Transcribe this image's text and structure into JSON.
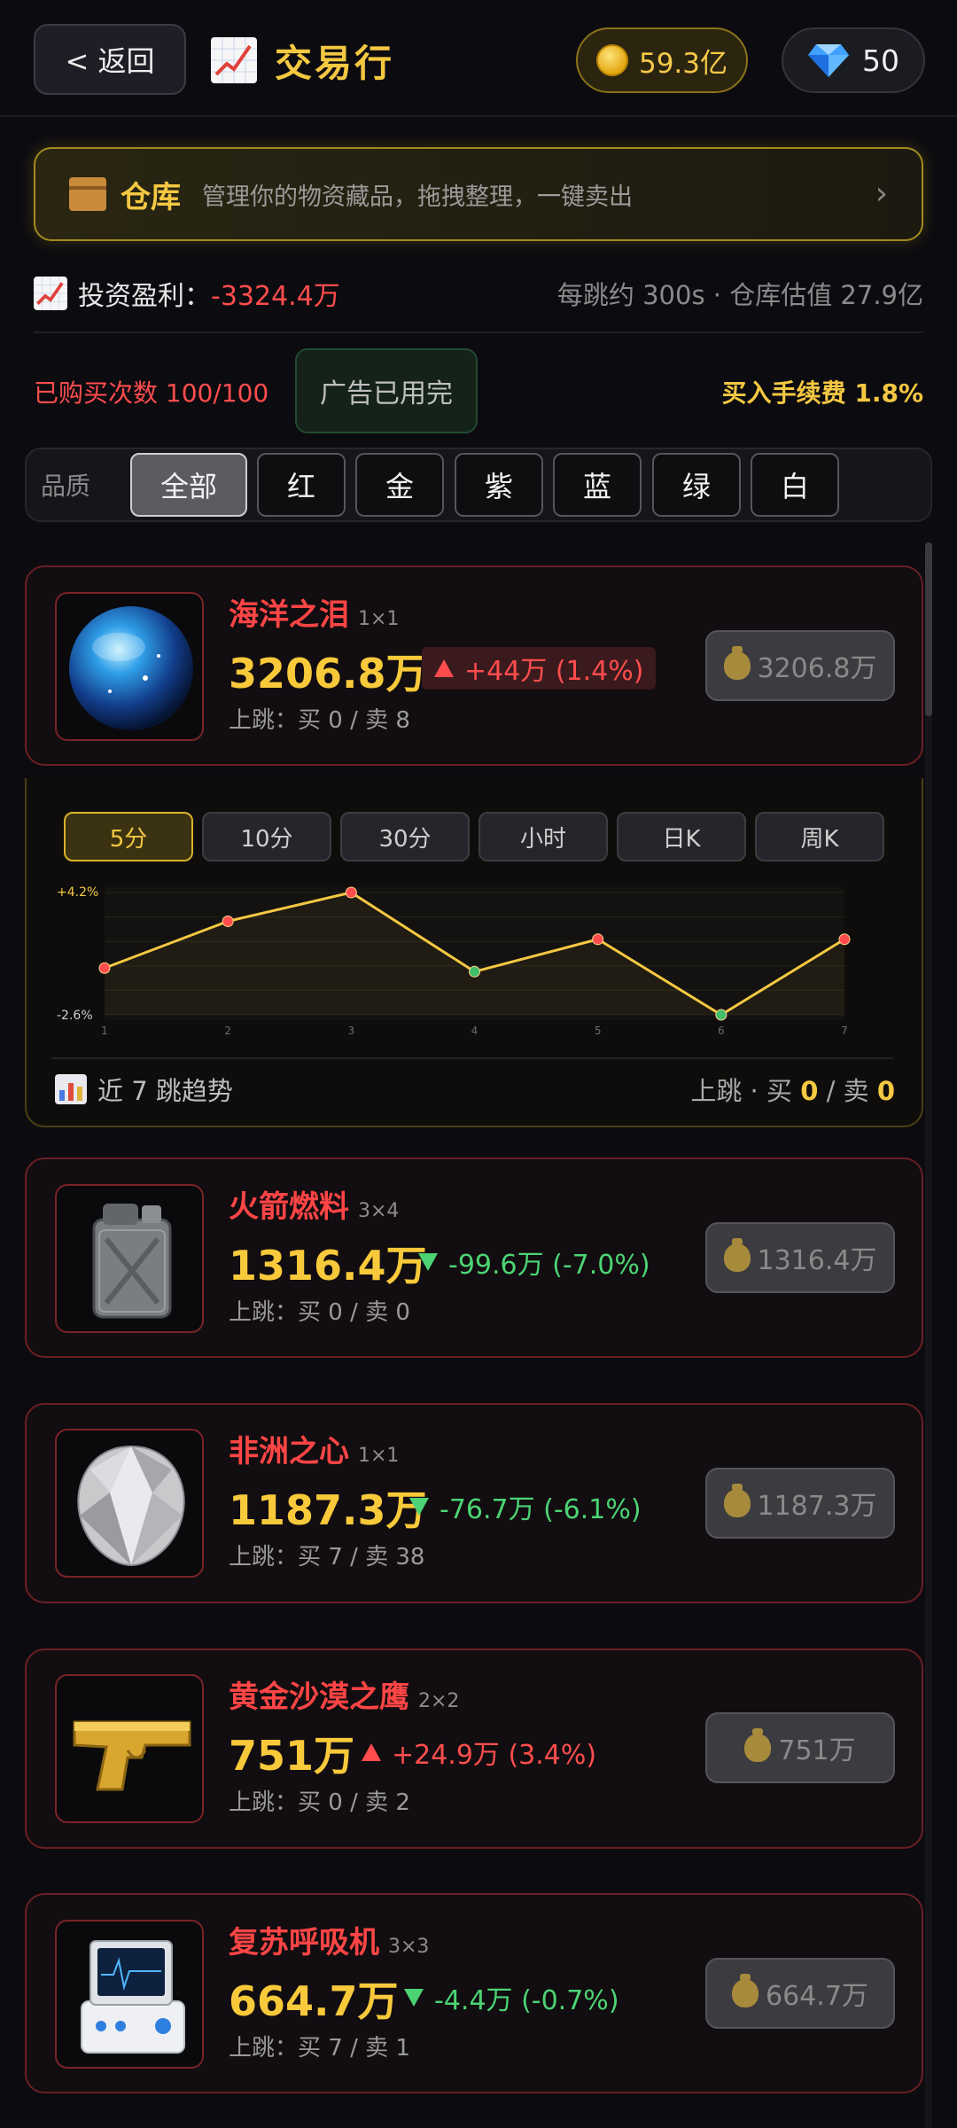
{
  "header": {
    "back_label": "< 返回",
    "title": "交易行",
    "coins": "59.3亿",
    "gems": "50"
  },
  "warehouse": {
    "title": "仓库",
    "desc": "管理你的物资藏品，拖拽整理，一键卖出",
    "arrow": "›"
  },
  "stats": {
    "profit_label": "投资盈利：",
    "profit_value": "-3324.4万",
    "right_text": "每跳约 300s · 仓库估值 27.9亿"
  },
  "purchase": {
    "count": "已购买次数 100/100",
    "ad_button": "广告已用完",
    "fee": "买入手续费 1.8%"
  },
  "filter": {
    "label": "品质",
    "options": [
      "全部",
      "红",
      "金",
      "紫",
      "蓝",
      "绿",
      "白"
    ],
    "selected": "全部"
  },
  "items": [
    {
      "name": "海洋之泪",
      "size": "1×1",
      "price": "3206.8万",
      "change": "+44万 (1.4%)",
      "direction": "up",
      "jump": "上跳：买 0 / 卖 8",
      "sell": "3206.8万",
      "icon": "ocean-orb-icon"
    },
    {
      "name": "火箭燃料",
      "size": "3×4",
      "price": "1316.4万",
      "change": "-99.6万 (-7.0%)",
      "direction": "down",
      "jump": "上跳：买 0 / 卖 0",
      "sell": "1316.4万",
      "icon": "jerrycan-icon"
    },
    {
      "name": "非洲之心",
      "size": "1×1",
      "price": "1187.3万",
      "change": "-76.7万 (-6.1%)",
      "direction": "down",
      "jump": "上跳：买 7 / 卖 38",
      "sell": "1187.3万",
      "icon": "diamond-icon"
    },
    {
      "name": "黄金沙漠之鹰",
      "size": "2×2",
      "price": "751万",
      "change": "+24.9万 (3.4%)",
      "direction": "up",
      "jump": "上跳：买 0 / 卖 2",
      "sell": "751万",
      "icon": "golden-pistol-icon"
    },
    {
      "name": "复苏呼吸机",
      "size": "3×3",
      "price": "664.7万",
      "change": "-4.4万 (-0.7%)",
      "direction": "down",
      "jump": "上跳：买 7 / 卖 1",
      "sell": "664.7万",
      "icon": "ventilator-icon"
    }
  ],
  "chart": {
    "timeframes": [
      "5分",
      "10分",
      "30分",
      "小时",
      "日K",
      "周K"
    ],
    "active_timeframe": "5分",
    "trend_label": "近 7 跳趋势",
    "trend_right_prefix": "上跳 · 买",
    "trend_right_mid": "/ 卖",
    "buy": "0",
    "sell": "0"
  },
  "chart_data": {
    "type": "line",
    "x": [
      1,
      2,
      3,
      4,
      5,
      6,
      7
    ],
    "values": [
      0.0,
      2.6,
      4.2,
      -0.2,
      1.6,
      -2.6,
      1.6
    ],
    "ylim": [
      -2.6,
      4.2
    ],
    "y_tick_labels": [
      "+4.2%",
      "-2.6%"
    ],
    "grid": true,
    "colors": {
      "line": "#f5c842",
      "up_point": "#ff4d4d",
      "down_point": "#3fbf6a"
    }
  }
}
